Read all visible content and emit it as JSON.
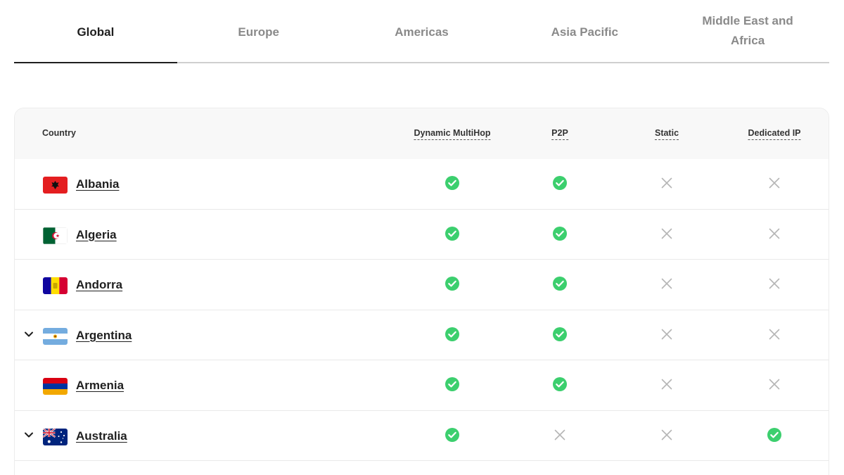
{
  "tabs": [
    {
      "label": "Global",
      "active": true
    },
    {
      "label": "Europe",
      "active": false
    },
    {
      "label": "Americas",
      "active": false
    },
    {
      "label": "Asia Pacific",
      "active": false
    },
    {
      "label": "Middle East and Africa",
      "active": false
    }
  ],
  "table": {
    "headers": {
      "country": "Country",
      "dynamic_multihop": "Dynamic MultiHop",
      "p2p": "P2P",
      "static": "Static",
      "dedicated_ip": "Dedicated IP"
    },
    "rows": [
      {
        "country": "Albania",
        "expandable": false,
        "flag": "albania-flag",
        "dynamic_multihop": true,
        "p2p": true,
        "static": false,
        "dedicated_ip": false
      },
      {
        "country": "Algeria",
        "expandable": false,
        "flag": "algeria-flag",
        "dynamic_multihop": true,
        "p2p": true,
        "static": false,
        "dedicated_ip": false
      },
      {
        "country": "Andorra",
        "expandable": false,
        "flag": "andorra-flag",
        "dynamic_multihop": true,
        "p2p": true,
        "static": false,
        "dedicated_ip": false
      },
      {
        "country": "Argentina",
        "expandable": true,
        "flag": "argentina-flag",
        "dynamic_multihop": true,
        "p2p": true,
        "static": false,
        "dedicated_ip": false
      },
      {
        "country": "Armenia",
        "expandable": false,
        "flag": "armenia-flag",
        "dynamic_multihop": true,
        "p2p": true,
        "static": false,
        "dedicated_ip": false
      },
      {
        "country": "Australia",
        "expandable": true,
        "flag": "australia-flag",
        "dynamic_multihop": true,
        "p2p": false,
        "static": false,
        "dedicated_ip": true
      }
    ]
  },
  "colors": {
    "check": "#3ccf6e",
    "cross": "#b5b5b5",
    "active_tab": "#1f1f1f",
    "inactive_tab": "#8a8a8a"
  },
  "icons": {
    "available": "check-circle-icon",
    "unavailable": "cross-icon",
    "expand": "chevron-down-icon"
  }
}
